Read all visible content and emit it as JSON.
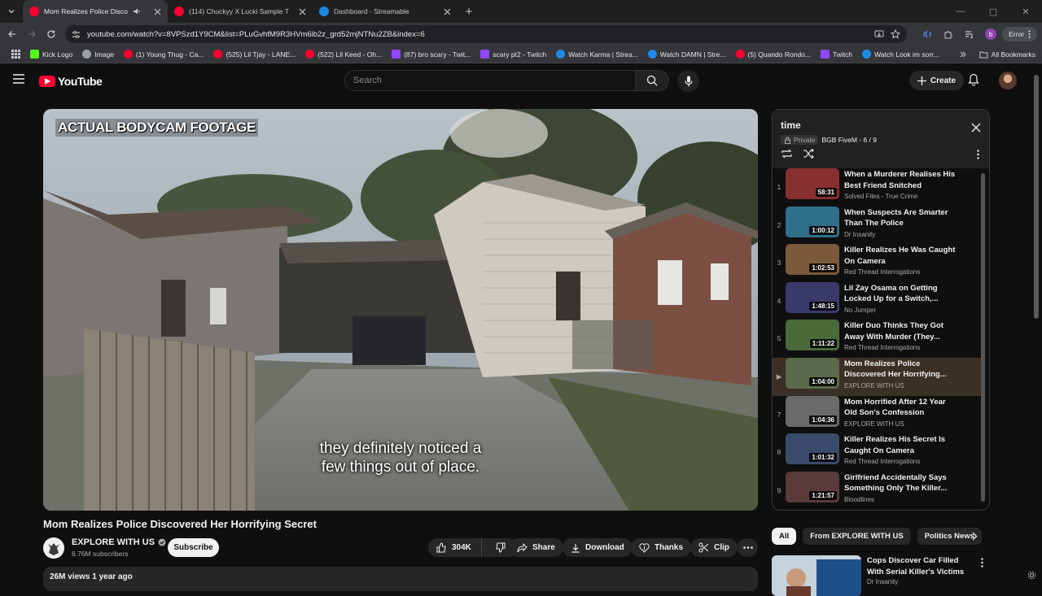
{
  "browser": {
    "tabs": [
      {
        "title": "Mom Realizes Police Disco",
        "favicon": "youtube-icon",
        "active": true,
        "audio": true
      },
      {
        "title": "(114) Chuckyy X Lucki Sample T",
        "favicon": "youtube-icon",
        "active": false
      },
      {
        "title": "Dashboard - Streamable",
        "favicon": "streamable-icon",
        "active": false
      }
    ],
    "url": "youtube.com/watch?v=8VPSzd1Y9CM&list=PLuGvhfM9R3HVm6ib2z_grd52mjNTNu2ZB&index=6",
    "profile_initial": "b",
    "error_label": "Error",
    "bookmarks": [
      {
        "label": "Kick Logo",
        "icon": "kick-icon",
        "color": "#53fc18"
      },
      {
        "label": "Image",
        "icon": "globe-icon",
        "color": "#9aa0a6"
      },
      {
        "label": "(1) Young Thug - Ca...",
        "icon": "youtube-icon",
        "color": "#ff0033"
      },
      {
        "label": "(525) Lil Tjay - LANE...",
        "icon": "youtube-icon",
        "color": "#ff0033"
      },
      {
        "label": "(522) Lil Keed - Oh...",
        "icon": "youtube-icon",
        "color": "#ff0033"
      },
      {
        "label": "(87) bro scary - Twit...",
        "icon": "twitch-icon",
        "color": "#9146ff"
      },
      {
        "label": "scary pt2 - Twitch",
        "icon": "twitch-icon",
        "color": "#9146ff"
      },
      {
        "label": "Watch Karma | Strea...",
        "icon": "streamable-icon",
        "color": "#1e88e5"
      },
      {
        "label": "Watch DAMN | Stre...",
        "icon": "streamable-icon",
        "color": "#1e88e5"
      },
      {
        "label": "(5) Quando Rondo...",
        "icon": "youtube-icon",
        "color": "#ff0033"
      },
      {
        "label": "Twitch",
        "icon": "twitch-icon",
        "color": "#9146ff"
      },
      {
        "label": "Watch Look im sorr...",
        "icon": "streamable-icon",
        "color": "#1e88e5"
      }
    ],
    "all_bookmarks": "All Bookmarks"
  },
  "youtube": {
    "logo_text": "YouTube",
    "search_placeholder": "Search",
    "create_label": "Create"
  },
  "video": {
    "overlay_banner": "ACTUAL BODYCAM FOOTAGE",
    "caption_line1": "they definitely noticed a",
    "caption_line2": "few things out of place.",
    "title": "Mom Realizes Police Discovered Her Horrifying Secret",
    "channel": "EXPLORE WITH US",
    "subscribers": "6.76M subscribers",
    "subscribe_label": "Subscribe",
    "likes": "304K",
    "share_label": "Share",
    "download_label": "Download",
    "thanks_label": "Thanks",
    "clip_label": "Clip",
    "views_date": "26M views  1 year ago"
  },
  "playlist": {
    "title": "time",
    "privacy": "Private",
    "owner_position": "BGB FiveM - 6 / 9",
    "items": [
      {
        "index": "1",
        "title": "When a Murderer Realises His Best Friend Snitched",
        "channel": "Solved Files - True Crime",
        "duration": "58:31",
        "thumb_color": "#8a2f2f"
      },
      {
        "index": "2",
        "title": "When Suspects Are Smarter Than The Police",
        "channel": "Dr Insanity",
        "duration": "1:00:12",
        "thumb_color": "#2f6f8a"
      },
      {
        "index": "3",
        "title": "Killer Realizes He Was Caught On Camera",
        "channel": "Red Thread Interrogations",
        "duration": "1:02:53",
        "thumb_color": "#7a5a3a"
      },
      {
        "index": "4",
        "title": "Lil Zay Osama on Getting Locked Up for a Switch,...",
        "channel": "No Jumper",
        "duration": "1:48:15",
        "thumb_color": "#3a3a6a"
      },
      {
        "index": "5",
        "title": "Killer Duo Thinks They Got Away With Murder (They...",
        "channel": "Red Thread Interrogations",
        "duration": "1:11:22",
        "thumb_color": "#4a6a3a"
      },
      {
        "index": "▶",
        "title": "Mom Realizes Police Discovered Her Horrifying...",
        "channel": "EXPLORE WITH US",
        "duration": "1:04:00",
        "thumb_color": "#5a6a4a",
        "current": true
      },
      {
        "index": "7",
        "title": "Mom Horrified After 12 Year Old Son's Confession",
        "channel": "EXPLORE WITH US",
        "duration": "1:04:36",
        "thumb_color": "#6a6a6a"
      },
      {
        "index": "8",
        "title": "Killer Realizes His Secret Is Caught On Camera",
        "channel": "Red Thread Interrogations",
        "duration": "1:01:32",
        "thumb_color": "#3a4a6a"
      },
      {
        "index": "9",
        "title": "Girlfriend Accidentally Says Something Only The Killer...",
        "channel": "Bloodlines",
        "duration": "1:21:57",
        "thumb_color": "#5a3a3a"
      }
    ]
  },
  "chips": [
    "All",
    "From EXPLORE WITH US",
    "Politics News"
  ],
  "recommendation": {
    "title": "Cops Discover Car Filled With Serial Killer's Victims",
    "channel": "Dr Insanity"
  },
  "colors": {
    "accent_red": "#ff0033",
    "background": "#0f0f0f",
    "current_item_bg": "#3b3025"
  }
}
